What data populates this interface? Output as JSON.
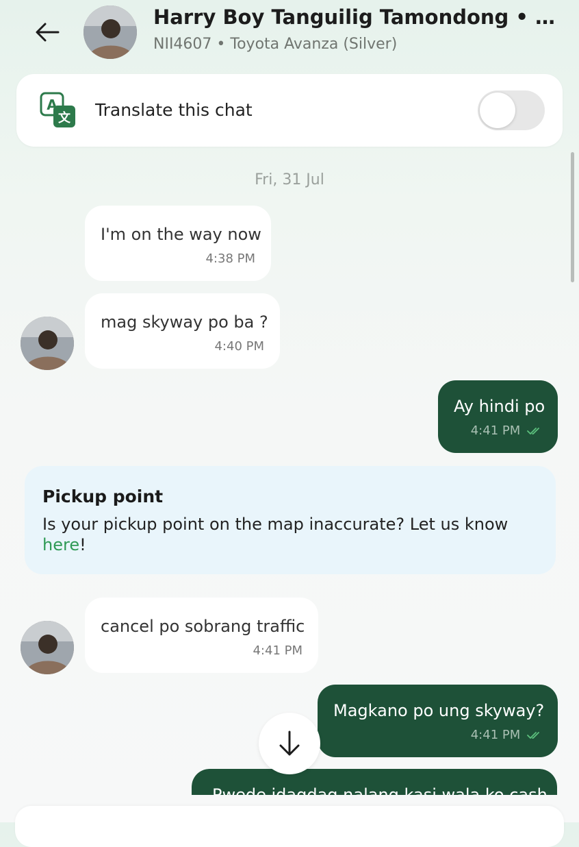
{
  "header": {
    "driver_name": "Harry Boy Tanguilig Tamondong • Sta...",
    "vehicle_info": "NII4607 • Toyota Avanza (Silver)"
  },
  "translate": {
    "label": "Translate this chat",
    "enabled": false
  },
  "date_separator": "Fri, 31 Jul",
  "messages": [
    {
      "direction": "incoming",
      "text": "I'm on the way now",
      "time": "4:38 PM"
    },
    {
      "direction": "incoming",
      "text": "mag skyway po ba ?",
      "time": "4:40 PM"
    },
    {
      "direction": "outgoing",
      "text": "Ay hindi po",
      "time": "4:41 PM"
    },
    {
      "direction": "incoming",
      "text": "cancel po sobrang traffic",
      "time": "4:41 PM"
    },
    {
      "direction": "outgoing",
      "text": "Magkano po ung skyway?",
      "time": "4:41 PM"
    },
    {
      "direction": "outgoing",
      "text": "Pwede idagdag nalang kasi wala ko cash",
      "time": ""
    }
  ],
  "pickup_card": {
    "title": "Pickup point",
    "body": "Is your pickup point on the map inaccurate? Let us know ",
    "link": "here",
    "suffix": "!"
  },
  "icons": {
    "back": "arrow-left-icon",
    "translate": "translate-icon",
    "scroll_down": "arrow-down-icon",
    "read_receipt": "double-check-icon"
  },
  "colors": {
    "outgoing_bubble": "#1e5138",
    "incoming_bubble": "#ffffff",
    "link": "#2f9a55",
    "info_card": "#e9f5fb"
  }
}
